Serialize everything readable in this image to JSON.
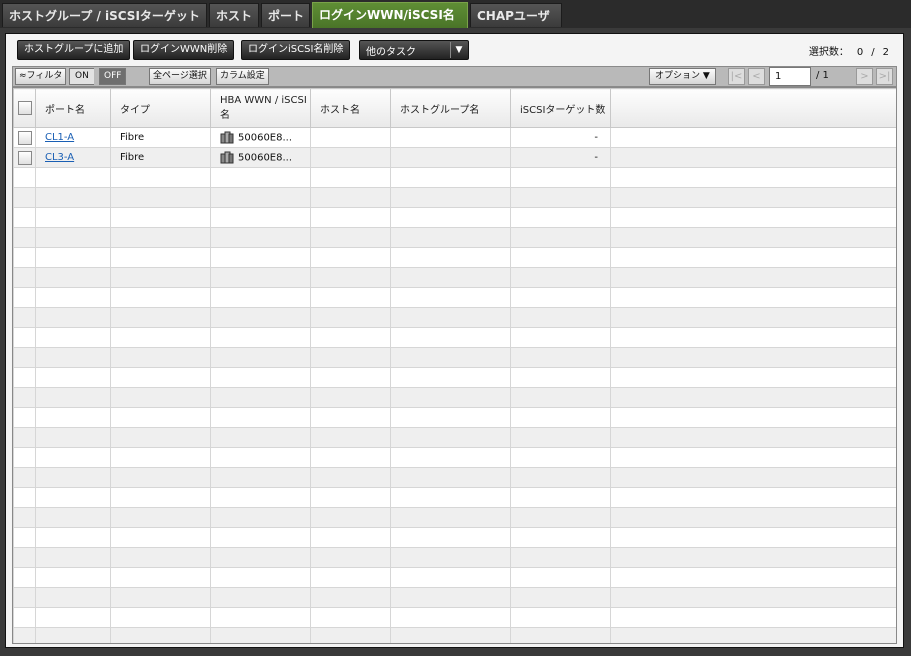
{
  "tabs": [
    {
      "label": "ホストグループ / iSCSIターゲット"
    },
    {
      "label": "ホスト"
    },
    {
      "label": "ポート"
    },
    {
      "label": "ログインWWN/iSCSI名"
    },
    {
      "label": "CHAPユーザ"
    }
  ],
  "toolbar": {
    "add_host_group": "ホストグループに追加",
    "delete_login_wwn": "ログインWWN削除",
    "delete_login_iscsi": "ログインiSCSI名削除",
    "other_tasks": "他のタスク",
    "selection_label": "選択数：",
    "selection_count": "0",
    "selection_sep": "/",
    "selection_total": "2"
  },
  "filterbar": {
    "filter": "≈フィルタ",
    "on": "ON",
    "off": "OFF",
    "select_all_pages": "全ページ選択",
    "column_settings": "カラム設定",
    "options": "オプション ▼",
    "page_current": "1",
    "page_total": "/ 1"
  },
  "table": {
    "headers": [
      "ポート名",
      "タイプ",
      "HBA WWN / iSCSI名",
      "ホスト名",
      "ホストグループ名",
      "iSCSIターゲット数"
    ],
    "rows": [
      {
        "port": "CL1-A",
        "type": "Fibre",
        "hba": "50060E8...",
        "host": "",
        "hostgroup": "",
        "targets": "-"
      },
      {
        "port": "CL3-A",
        "type": "Fibre",
        "hba": "50060E8...",
        "host": "",
        "hostgroup": "",
        "targets": "-"
      }
    ]
  },
  "colors": {
    "active_tab": "#5f8e35",
    "panel_bg": "#f4f4f4",
    "link": "#1a5fb4"
  }
}
